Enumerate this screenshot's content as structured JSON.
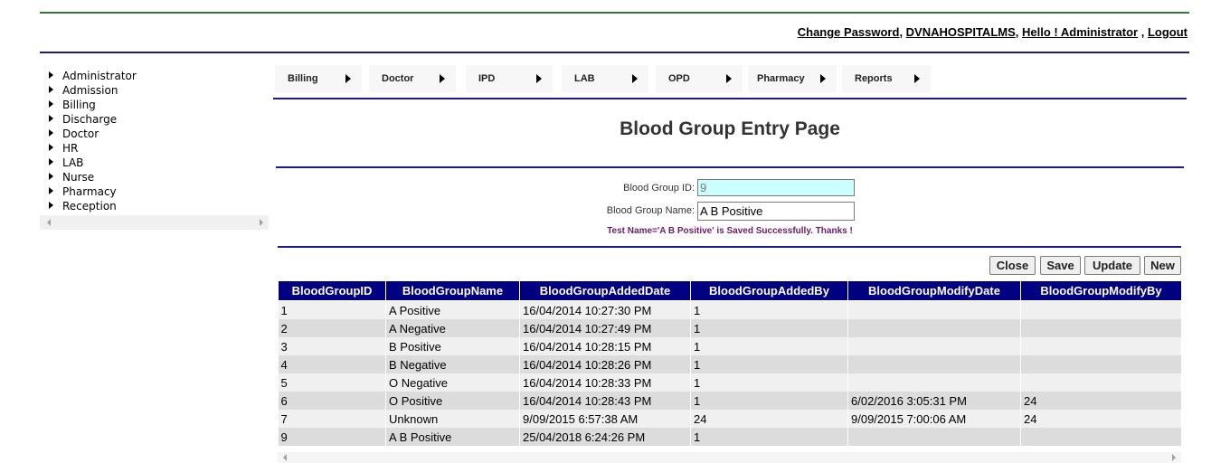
{
  "header": {
    "change_password": "Change Password",
    "hospital": "DVNAHOSPITALMS",
    "greeting": "Hello ! Administrator",
    "logout": "Logout"
  },
  "sidebar": {
    "items": [
      "Administrator",
      "Admission",
      "Billing",
      "Discharge",
      "Doctor",
      "HR",
      "LAB",
      "Nurse",
      "Pharmacy",
      "Reception"
    ]
  },
  "menu": {
    "items": [
      "Billing",
      "Doctor",
      "IPD",
      "LAB",
      "OPD",
      "Pharmacy",
      "Reports"
    ]
  },
  "page": {
    "title": "Blood Group Entry Page"
  },
  "form": {
    "id_label": "Blood Group ID:",
    "id_value": "9",
    "name_label": "Blood Group Name:",
    "name_value": "A B Positive",
    "message": "Test Name='A B Positive' is Saved Successfully. Thanks !"
  },
  "buttons": {
    "close": "Close",
    "save": "Save",
    "update": "Update",
    "new": "New"
  },
  "grid": {
    "columns": [
      "BloodGroupID",
      "BloodGroupName",
      "BloodGroupAddedDate",
      "BloodGroupAddedBy",
      "BloodGroupModifyDate",
      "BloodGroupModifyBy"
    ],
    "rows": [
      [
        "1",
        "A Positive",
        "16/04/2014 10:27:30 PM",
        "1",
        "",
        ""
      ],
      [
        "2",
        "A Negative",
        "16/04/2014 10:27:49 PM",
        "1",
        "",
        ""
      ],
      [
        "3",
        "B Positive",
        "16/04/2014 10:28:15 PM",
        "1",
        "",
        ""
      ],
      [
        "4",
        "B Negative",
        "16/04/2014 10:28:26 PM",
        "1",
        "",
        ""
      ],
      [
        "5",
        "O Negative",
        "16/04/2014 10:28:33 PM",
        "1",
        "",
        ""
      ],
      [
        "6",
        "O Positive",
        "16/04/2014 10:28:43 PM",
        "1",
        "6/02/2016 3:05:31 PM",
        "24"
      ],
      [
        "7",
        "Unknown",
        "9/09/2015 6:57:38 AM",
        "24",
        "9/09/2015 7:00:06 AM",
        "24"
      ],
      [
        "9",
        "A B Positive",
        "25/04/2018 6:24:26 PM",
        "1",
        "",
        ""
      ]
    ]
  },
  "colors": {
    "header_line": "#2e7d32",
    "navy": "#000080",
    "message": "#6a1b6a",
    "id_field_bg": "#ccffff"
  }
}
